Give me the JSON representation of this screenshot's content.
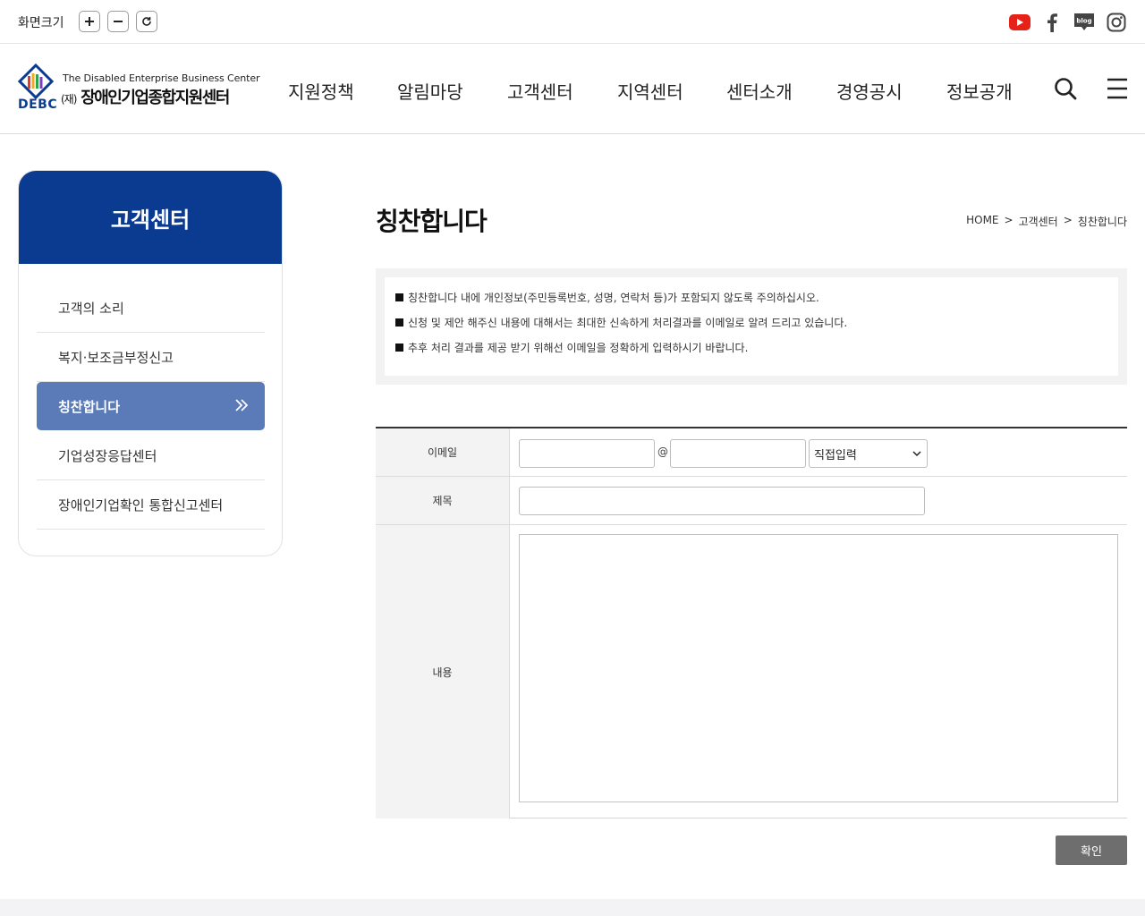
{
  "utility": {
    "zoom_label": "화면크기",
    "zoom_in": "+",
    "zoom_out": "−",
    "zoom_reset": "↻",
    "sns": [
      "youtube-icon",
      "facebook-icon",
      "blog-icon",
      "instagram-icon"
    ],
    "blog_text": "blog"
  },
  "header": {
    "logo_en": "The Disabled Enterprise Business Center",
    "logo_prefix": "(재)",
    "logo_ko": "장애인기업종합지원센터",
    "logo_abbr": "DEBC",
    "gnb": [
      "지원정책",
      "알림마당",
      "고객센터",
      "지역센터",
      "센터소개",
      "경영공시",
      "정보공개"
    ]
  },
  "sidebar": {
    "title": "고객센터",
    "items": [
      {
        "label": "고객의 소리",
        "active": false
      },
      {
        "label": "복지·보조금부정신고",
        "active": false
      },
      {
        "label": "칭찬합니다",
        "active": true
      },
      {
        "label": "기업성장응답센터",
        "active": false
      },
      {
        "label": "장애인기업확인 통합신고센터",
        "active": false
      }
    ]
  },
  "page": {
    "title": "칭찬합니다",
    "breadcrumb": [
      "HOME",
      "고객센터",
      "칭찬합니다"
    ],
    "breadcrumb_sep": ">"
  },
  "notice": [
    "칭찬합니다 내에 개인정보(주민등록번호, 성명, 연락처 등)가 포함되지 않도록 주의하십시오.",
    "신청 및 제안 해주신 내용에 대해서는 최대한 신속하게 처리결과를 이메일로 알려 드리고 있습니다.",
    "추후 처리 결과를 제공 받기 위해선 이메일을 정확하게 입력하시기 바랍니다."
  ],
  "form": {
    "email_label": "이메일",
    "at_symbol": "@",
    "email_id_value": "",
    "email_domain_value": "",
    "domain_select": "직접입력",
    "subject_label": "제목",
    "subject_value": "",
    "content_label": "내용",
    "content_value": "",
    "submit_label": "확인"
  },
  "colors": {
    "brand_navy": "#0b3a91",
    "active_nav": "#5a7ab8",
    "submit_bg": "#6e6e6e",
    "youtube_red": "#e62117"
  }
}
